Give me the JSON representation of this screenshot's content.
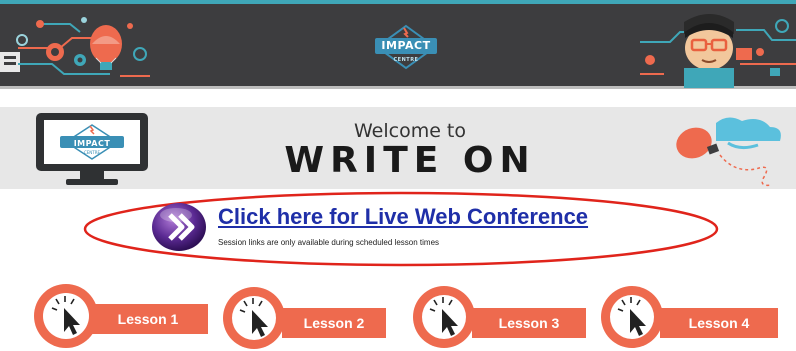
{
  "header": {
    "logo": {
      "title": "IMPACT",
      "subtitle": "CENTRE"
    },
    "colors": {
      "bar": "#3d3d3f",
      "accent_line": "#3fa7b8",
      "badge": "#3a8fb5"
    }
  },
  "welcome": {
    "line1": "Welcome to",
    "line2": "WRITE ON",
    "monitor_logo": {
      "title": "IMPACT",
      "subtitle": "CENTRE"
    }
  },
  "conference": {
    "link_text": "Click here for Live Web Conference",
    "note": "Session links are only available during scheduled lesson times",
    "oval_color": "#e0241b"
  },
  "lessons": [
    {
      "label": "Lesson 1"
    },
    {
      "label": "Lesson 2"
    },
    {
      "label": "Lesson 3"
    },
    {
      "label": "Lesson 4"
    }
  ],
  "colors": {
    "lesson_orange": "#ee6a4e",
    "link_blue": "#1f2fa8"
  }
}
